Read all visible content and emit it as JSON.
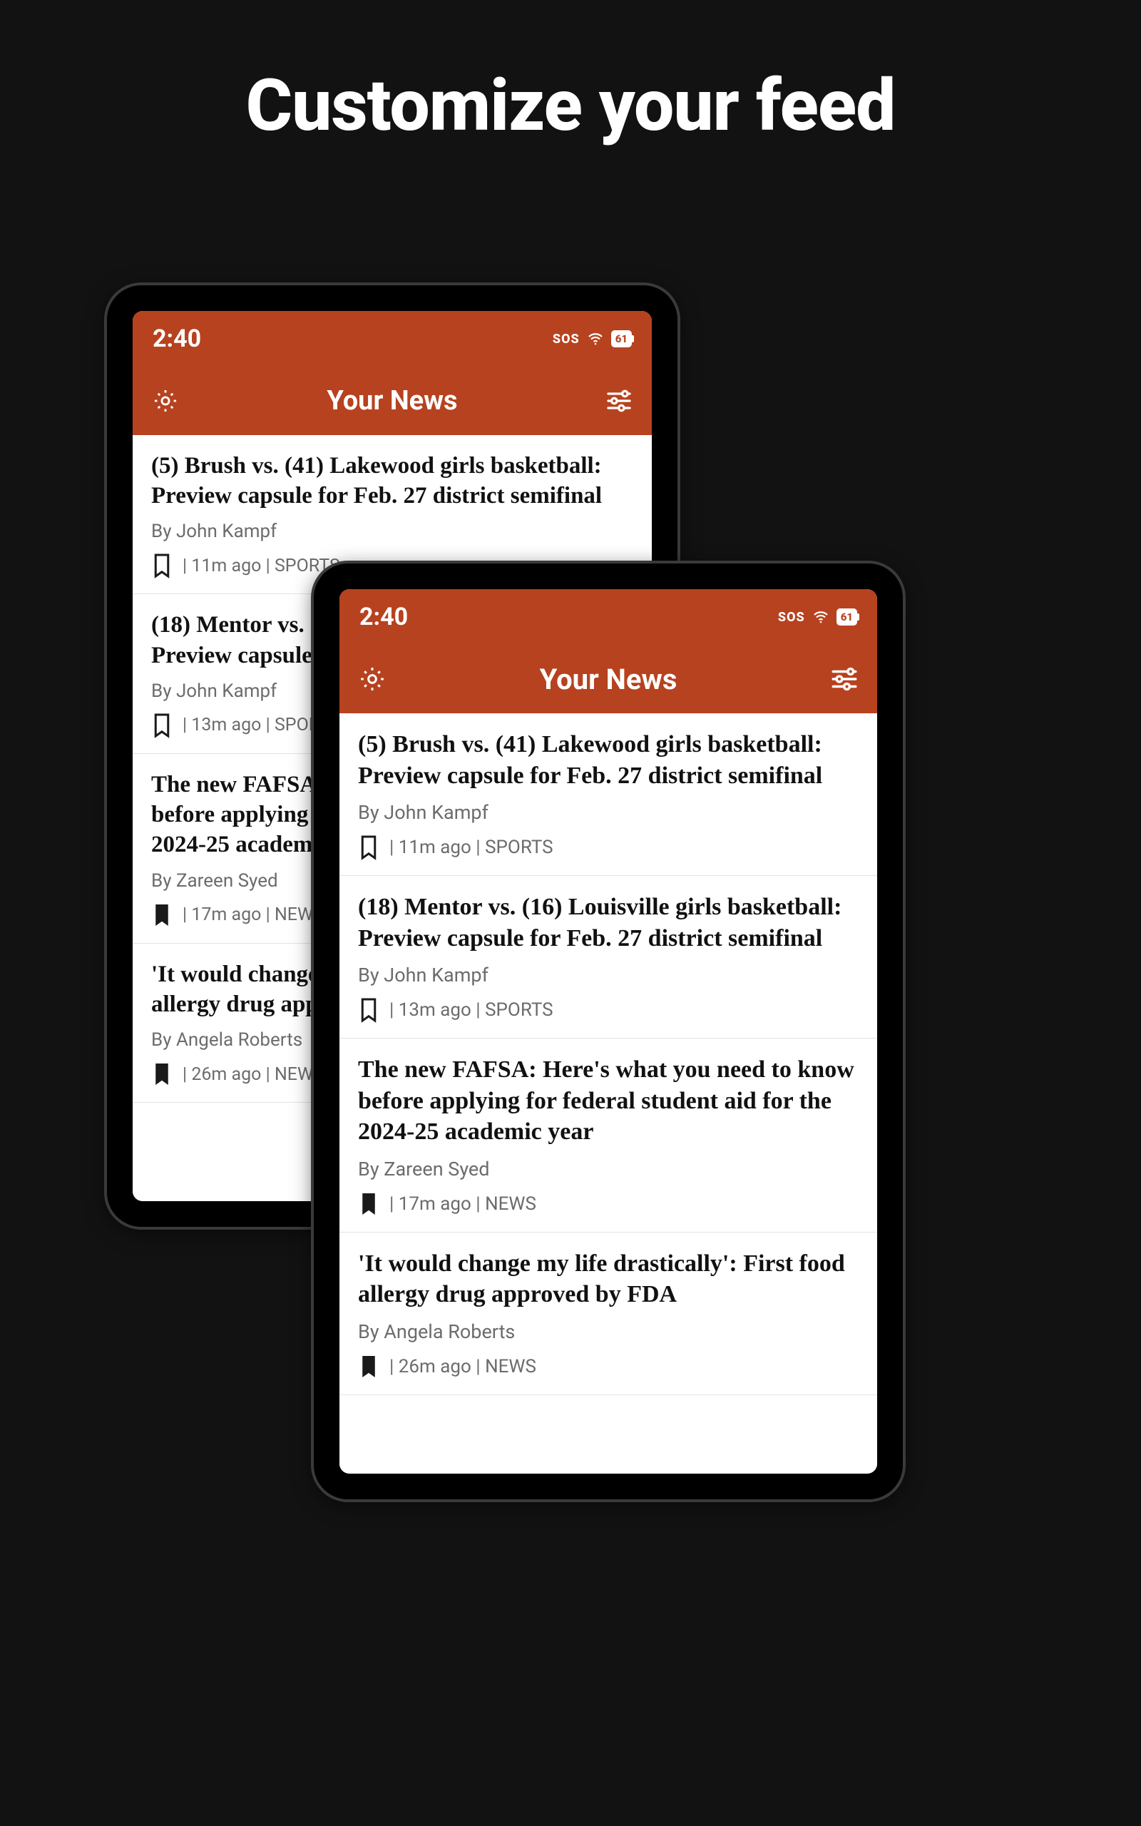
{
  "hero": {
    "title": "Customize your feed"
  },
  "status": {
    "time": "2:40",
    "sos": "SOS",
    "battery": "61"
  },
  "nav": {
    "title": "Your News"
  },
  "articles": [
    {
      "title": "(5) Brush vs. (41) Lakewood girls basketball: Preview capsule for Feb. 27 district semifinal",
      "author": "By John Kampf",
      "time": "11m ago",
      "category": "SPORTS",
      "bookmarked": false
    },
    {
      "title": "(18) Mentor vs. (16) Louisville girls basketball: Preview capsule for Feb. 27 district semifinal",
      "author": "By John Kampf",
      "time": "13m ago",
      "category": "SPORTS",
      "bookmarked": false
    },
    {
      "title": "The new FAFSA: Here's what you need to know before applying for federal student aid for the 2024-25 academic year",
      "author": "By Zareen Syed",
      "time": "17m ago",
      "category": "NEWS",
      "bookmarked": true
    },
    {
      "title": "'It would change my life drastically': First food allergy drug approved by FDA",
      "author": "By Angela Roberts",
      "time": "26m ago",
      "category": "NEWS",
      "bookmarked": true
    }
  ]
}
